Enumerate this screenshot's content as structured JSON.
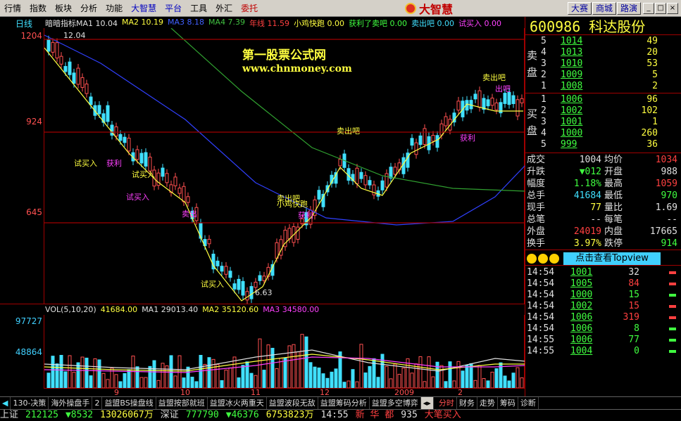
{
  "menu": [
    "行情",
    "指数",
    "板块",
    "分析",
    "功能",
    "大智慧",
    "平台",
    "工具",
    "外汇",
    "委托"
  ],
  "logo": "大智慧",
  "top_buttons": [
    "大赛",
    "商城",
    "路演"
  ],
  "window_buttons": [
    "_",
    "□",
    "×"
  ],
  "chart": {
    "period_label": "日线",
    "indicator_line": [
      {
        "text": "暗暗指标MA1 10.04",
        "color": "#e0e0e0"
      },
      {
        "text": "MA2 10.19",
        "color": "#ffff40"
      },
      {
        "text": "MA3 8.18",
        "color": "#4060ff"
      },
      {
        "text": "MA4 7.39",
        "color": "#40c040"
      },
      {
        "text": "年线 11.59",
        "color": "#ff4040"
      },
      {
        "text": "小鸡快跑 0.00",
        "color": "#ffff40"
      },
      {
        "text": "获利了卖吧 0.00",
        "color": "#40ff40"
      },
      {
        "text": "卖出吧 0.00",
        "color": "#40e0ff"
      },
      {
        "text": "试买入 0.00",
        "color": "#ff40ff"
      }
    ],
    "price_labels": [
      "1204",
      "924",
      "645"
    ],
    "high_label": "12.04",
    "low_label": "6.63",
    "watermark_title": "第一股票公式网",
    "watermark_url": "www.chnmoney.com",
    "annotations": [
      "试买入",
      "获利",
      "试买入",
      "试买入",
      "卖出",
      "卖出吧",
      "小鸡快跑",
      "获利",
      "卖出吧",
      "获利",
      "卖出吧",
      "试买入",
      "出吧"
    ],
    "vol_line": [
      {
        "text": "VOL(5,10,20)",
        "color": "#e0e0e0"
      },
      {
        "text": "41684.00",
        "color": "#ffff40"
      },
      {
        "text": "MA1 29013.40",
        "color": "#e0e0e0"
      },
      {
        "text": "MA2 35120.60",
        "color": "#ffff40"
      },
      {
        "text": "MA3 34580.00",
        "color": "#ff40ff"
      }
    ],
    "vol_labels": [
      "97727",
      "48864"
    ],
    "x_labels": [
      "9",
      "10",
      "11",
      "12",
      "2009",
      "2"
    ]
  },
  "quote": {
    "code_name": "600986 科达股份",
    "sell_label": [
      "卖",
      "盘"
    ],
    "buy_label": [
      "买",
      "盘"
    ],
    "sells": [
      {
        "lvl": "5",
        "price": "1014",
        "vol": "49"
      },
      {
        "lvl": "4",
        "price": "1013",
        "vol": "20"
      },
      {
        "lvl": "3",
        "price": "1010",
        "vol": "53"
      },
      {
        "lvl": "2",
        "price": "1009",
        "vol": "5"
      },
      {
        "lvl": "1",
        "price": "1008",
        "vol": "2"
      }
    ],
    "buys": [
      {
        "lvl": "1",
        "price": "1006",
        "vol": "96"
      },
      {
        "lvl": "2",
        "price": "1002",
        "vol": "102"
      },
      {
        "lvl": "3",
        "price": "1001",
        "vol": "1"
      },
      {
        "lvl": "4",
        "price": "1000",
        "vol": "260"
      },
      {
        "lvl": "5",
        "price": "999",
        "vol": "36"
      }
    ],
    "stats": [
      {
        "k1": "成交",
        "v1": "1004",
        "k2": "均价",
        "v2": "1034"
      },
      {
        "k1": "升跌",
        "v1": "▼012",
        "k2": "开盘",
        "v2": "988"
      },
      {
        "k1": "幅度",
        "v1": "1.18%",
        "k2": "最高",
        "v2": "1059"
      },
      {
        "k1": "总手",
        "v1": "41684",
        "k2": "最低",
        "v2": "970"
      },
      {
        "k1": "现手",
        "v1": "77",
        "k2": "量比",
        "v2": "1.69"
      },
      {
        "k1": "总笔",
        "v1": "--",
        "k2": "每笔",
        "v2": "--"
      },
      {
        "k1": "外盘",
        "v1": "24019",
        "k2": "内盘",
        "v2": "17665"
      },
      {
        "k1": "换手",
        "v1": "3.97%",
        "k2": "跌停",
        "v2": "914"
      }
    ],
    "topview": "点击查看Topview",
    "ticks": [
      {
        "t": "14:54",
        "p": "1001",
        "v": "32",
        "c": "#e0e0e0"
      },
      {
        "t": "14:54",
        "p": "1005",
        "v": "84",
        "c": "#ff4040"
      },
      {
        "t": "14:54",
        "p": "1000",
        "v": "15",
        "c": "#40ff40"
      },
      {
        "t": "14:54",
        "p": "1002",
        "v": "15",
        "c": "#ff4040"
      },
      {
        "t": "14:54",
        "p": "1006",
        "v": "319",
        "c": "#ff4040"
      },
      {
        "t": "14:54",
        "p": "1006",
        "v": "8",
        "c": "#40ff40"
      },
      {
        "t": "14:55",
        "p": "1006",
        "v": "77",
        "c": "#40ff40"
      },
      {
        "t": "14:55",
        "p": "1004",
        "v": "0",
        "c": "#40ff40"
      }
    ],
    "right_tabs": [
      "分时",
      "财务",
      "走势",
      "筹码",
      "诊断"
    ]
  },
  "bottom_tabs": [
    "130-决策",
    "海外操盘手",
    "2",
    "益盟BS操盘线",
    "益盟按部就班",
    "益盟冰火两重天",
    "益盟波段无敌",
    "益盟筹码分析",
    "益盟多空博弈"
  ],
  "status": [
    {
      "text": "上证",
      "color": "#e0e0e0"
    },
    {
      "text": "212125",
      "color": "#40ff40"
    },
    {
      "text": "▼8532",
      "color": "#40ff40"
    },
    {
      "text": "13026067万",
      "color": "#ffff40"
    },
    {
      "text": "深证",
      "color": "#e0e0e0"
    },
    {
      "text": "777790",
      "color": "#40ff40"
    },
    {
      "text": "▼46376",
      "color": "#40ff40"
    },
    {
      "text": "6753823万",
      "color": "#ffff40"
    },
    {
      "text": "14:55",
      "color": "#e0e0e0"
    },
    {
      "text": "新 华 都",
      "color": "#ff4040"
    },
    {
      "text": "935",
      "color": "#e0e0e0"
    },
    {
      "text": "大笔买入",
      "color": "#ff4040"
    }
  ]
}
